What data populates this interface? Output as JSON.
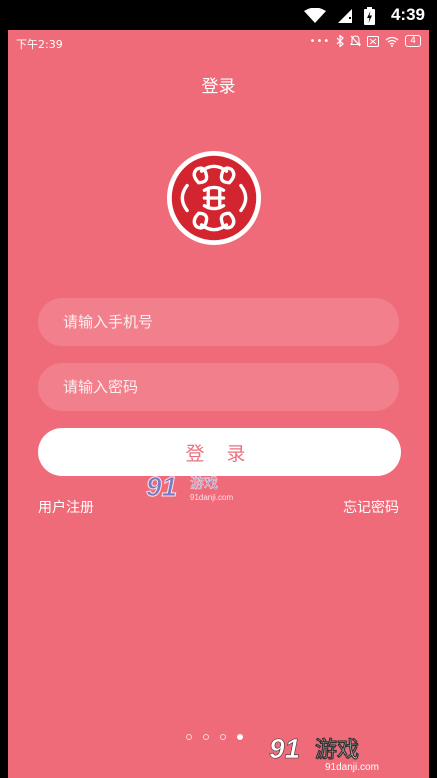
{
  "outer_status": {
    "time": "4:39"
  },
  "inner_status": {
    "time": "下午2:39",
    "battery_level": "4"
  },
  "header": {
    "title": "登录"
  },
  "login_form": {
    "phone_placeholder": "请输入手机号",
    "password_placeholder": "请输入密码",
    "login_label": "登 录",
    "register_label": "用户注册",
    "forgot_label": "忘记密码"
  },
  "pager": {
    "total": 4,
    "active": 4
  },
  "watermark": {
    "brand": "91游戏",
    "site": "91danji.com"
  },
  "colors": {
    "background": "#f06b7a",
    "logo_red": "#d3252f",
    "button_text": "#e8737f"
  },
  "icons": [
    "wifi-icon",
    "sim-no-signal-icon",
    "battery-charging-icon",
    "bluetooth-icon",
    "mute-icon",
    "wifi-small-icon",
    "battery-small-icon",
    "app-logo-icon"
  ]
}
